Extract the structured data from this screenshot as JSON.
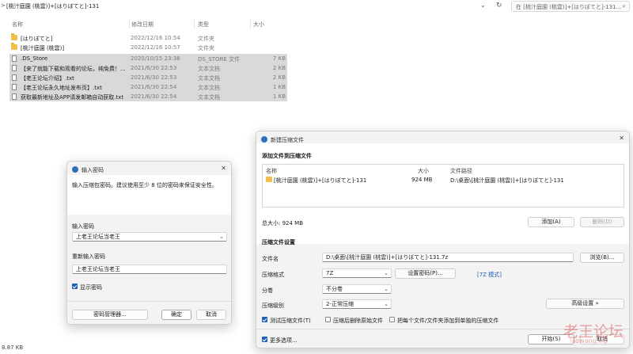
{
  "explorer": {
    "breadcrumb_prefix": ">",
    "path": "[桃汁庭園 (桃雲)]+[はりぼてと]-131",
    "dropdown_glyph": "⌄",
    "refresh_glyph": "↻",
    "search_placeholder": "在 [桃汁庭園 (桃雲)]+[はりぼてと]-131...",
    "search_glyph": "⌕",
    "columns": {
      "name": "名称",
      "date": "修改日期",
      "type": "类型",
      "size": "大小"
    },
    "files": [
      {
        "name": "[はりぼてと]",
        "date": "2022/12/16 10:54",
        "type": "文件夹",
        "size": "",
        "icon": "folder-icon"
      },
      {
        "name": "[桃汁庭園 (桃雲)]",
        "date": "2022/12/16 10:57",
        "type": "文件夹",
        "size": "",
        "icon": "folder-icon"
      },
      {
        "name": ".DS_Store",
        "date": "2020/10/15 23:36",
        "type": "DS_STORE 文件",
        "size": "7 KB",
        "icon": "file-icon"
      },
      {
        "name": "【来了就能下载和观看的论坛，纯免费！...",
        "date": "2021/6/30 22:53",
        "type": "文本文档",
        "size": "2 KB",
        "icon": "text-file-icon"
      },
      {
        "name": "【老王论坛介绍】.txt",
        "date": "2021/6/30 22:53",
        "type": "文本文档",
        "size": "2 KB",
        "icon": "text-file-icon"
      },
      {
        "name": "【老王论坛永久地址发布页】.txt",
        "date": "2021/6/30 22:54",
        "type": "文本文档",
        "size": "1 KB",
        "icon": "text-file-icon"
      },
      {
        "name": "获取最新地址及APP请发邮箱自动获取.txt",
        "date": "2021/6/30 22:54",
        "type": "文本文档",
        "size": "1 KB",
        "icon": "text-file-icon"
      }
    ],
    "status": "8.87 KB"
  },
  "password_dialog": {
    "title": "输入密码",
    "close": "✕",
    "description": "输入压缩包密码。建议使用至少 8 位的密码来保证安全性。",
    "password_label": "输入密码",
    "password_value": "上老王论坛当老王",
    "reenter_label": "重新输入密码",
    "reenter_value": "上老王论坛当老王",
    "show_password_label": "显示密码",
    "show_password_checked": true,
    "manager_button": "密码管理器...",
    "ok_button": "确定",
    "cancel_button": "取消"
  },
  "archive_dialog": {
    "title": "新建压缩文件",
    "close": "✕",
    "section_add": "添加文件到压缩文件",
    "list_headers": {
      "name": "名称",
      "size": "大小",
      "path": "文件路径"
    },
    "list_items": [
      {
        "name": "[桃汁庭園 (桃雲)]+[はりぼてと]-131",
        "size": "924 MB",
        "path": "D:\\桌面\\[桃汁庭園 (桃雲)]+[はりぼてと]-131"
      }
    ],
    "total_size": "总大小: 924 MB",
    "add_button": "添加(A)",
    "delete_button": "删除(D)",
    "section_settings": "压缩文件设置",
    "filename_label": "文件名",
    "filename_value": "D:\\桌面\\[桃汁庭園 (桃雲)]+[はりぼてと]-131.7z",
    "browse_button": "浏览(B)...",
    "format_label": "压缩格式",
    "format_value": "7Z",
    "set_password_button": "设置密码(P)...",
    "format_mode_link": "[7Z 模式]",
    "split_label": "分卷",
    "split_value": "不分卷",
    "level_label": "压缩级别",
    "level_value": "2-正常压缩",
    "advanced_button": "高级设置 »",
    "test_label": "测试压缩文件(T)",
    "test_checked": true,
    "delete_after_label": "压缩后删除原始文件",
    "delete_after_checked": false,
    "separate_label": "把每个文件/文件夹添加到单独的压缩文件",
    "separate_checked": false,
    "more_options_label": "更多选项...",
    "more_options_checked": true,
    "start_button": "开始(S)",
    "cancel_button": "取消"
  },
  "watermark": {
    "main": "老王论坛",
    "sub": "laowang.vip"
  },
  "colors": {
    "accent": "#1f5fb4",
    "selection": "#d9d9d9",
    "folder": "#f1c04b",
    "watermark": "#e25a5a"
  }
}
